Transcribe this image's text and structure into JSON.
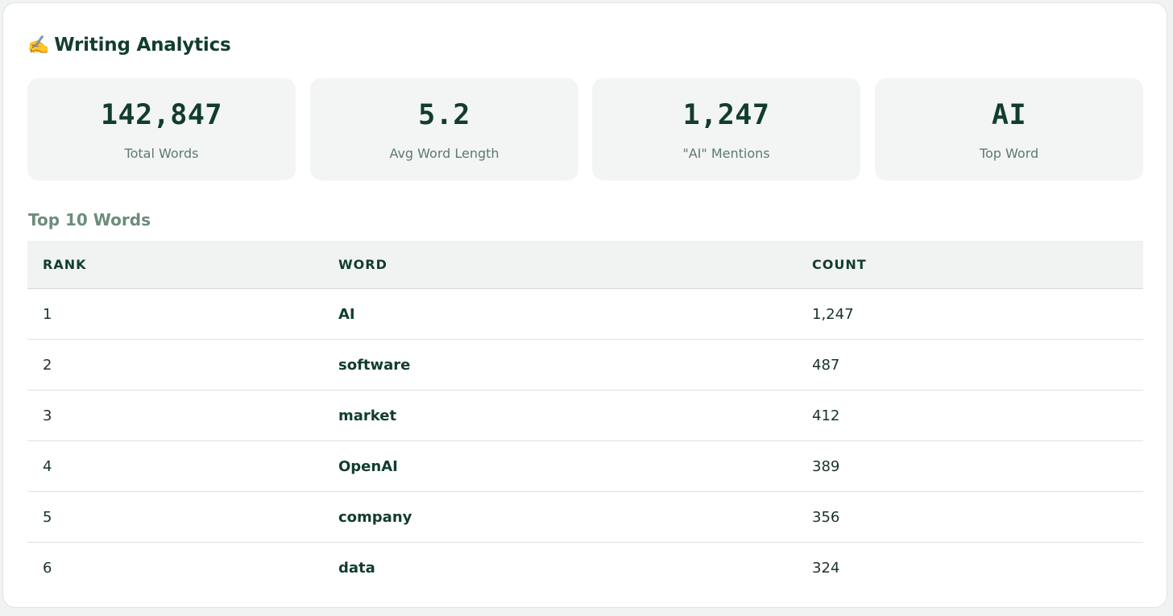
{
  "header": {
    "icon": "writing-hand-icon",
    "icon_glyph": "✍️",
    "title": "Writing Analytics"
  },
  "stats": [
    {
      "value": "142,847",
      "label": "Total Words"
    },
    {
      "value": "5.2",
      "label": "Avg Word Length"
    },
    {
      "value": "1,247",
      "label": "\"AI\" Mentions"
    },
    {
      "value": "AI",
      "label": "Top Word"
    }
  ],
  "table": {
    "section_title": "Top 10 Words",
    "columns": [
      "RANK",
      "WORD",
      "COUNT"
    ],
    "rows": [
      {
        "rank": "1",
        "word": "AI",
        "count": "1,247"
      },
      {
        "rank": "2",
        "word": "software",
        "count": "487"
      },
      {
        "rank": "3",
        "word": "market",
        "count": "412"
      },
      {
        "rank": "4",
        "word": "OpenAI",
        "count": "389"
      },
      {
        "rank": "5",
        "word": "company",
        "count": "356"
      },
      {
        "rank": "6",
        "word": "data",
        "count": "324"
      }
    ]
  },
  "colors": {
    "primary_text": "#123d2c",
    "muted_text": "#5f7a6c",
    "section_title": "#6b8d7c",
    "card_background": "#f3f5f4"
  }
}
